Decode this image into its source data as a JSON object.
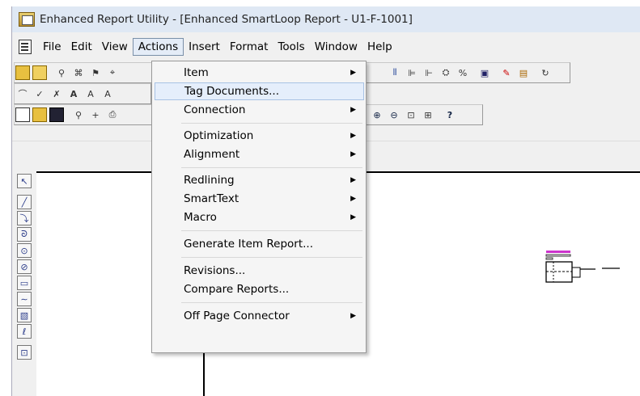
{
  "window": {
    "title": "Enhanced Report Utility - [Enhanced SmartLoop Report - U1-F-1001]"
  },
  "menubar": {
    "items": [
      "File",
      "Edit",
      "View",
      "Actions",
      "Insert",
      "Format",
      "Tools",
      "Window",
      "Help"
    ],
    "active": "Actions"
  },
  "actions_menu": {
    "items": [
      {
        "label": "Item",
        "submenu": true
      },
      {
        "label": "Tag Documents...",
        "submenu": false,
        "highlighted": true
      },
      {
        "label": "Connection",
        "submenu": true
      },
      {
        "label": "Optimization",
        "submenu": true
      },
      {
        "label": "Alignment",
        "submenu": true
      },
      {
        "label": "Redlining",
        "submenu": true
      },
      {
        "label": "SmartText",
        "submenu": true
      },
      {
        "label": "Macro",
        "submenu": true
      },
      {
        "label": "Generate Item Report...",
        "submenu": false
      },
      {
        "label": "Revisions...",
        "submenu": false
      },
      {
        "label": "Compare Reports...",
        "submenu": false
      },
      {
        "label": "Off Page Connector",
        "submenu": true
      }
    ]
  },
  "colors": {
    "highlight": "#e5eefb",
    "symbol_accent": "#cc33cc"
  }
}
